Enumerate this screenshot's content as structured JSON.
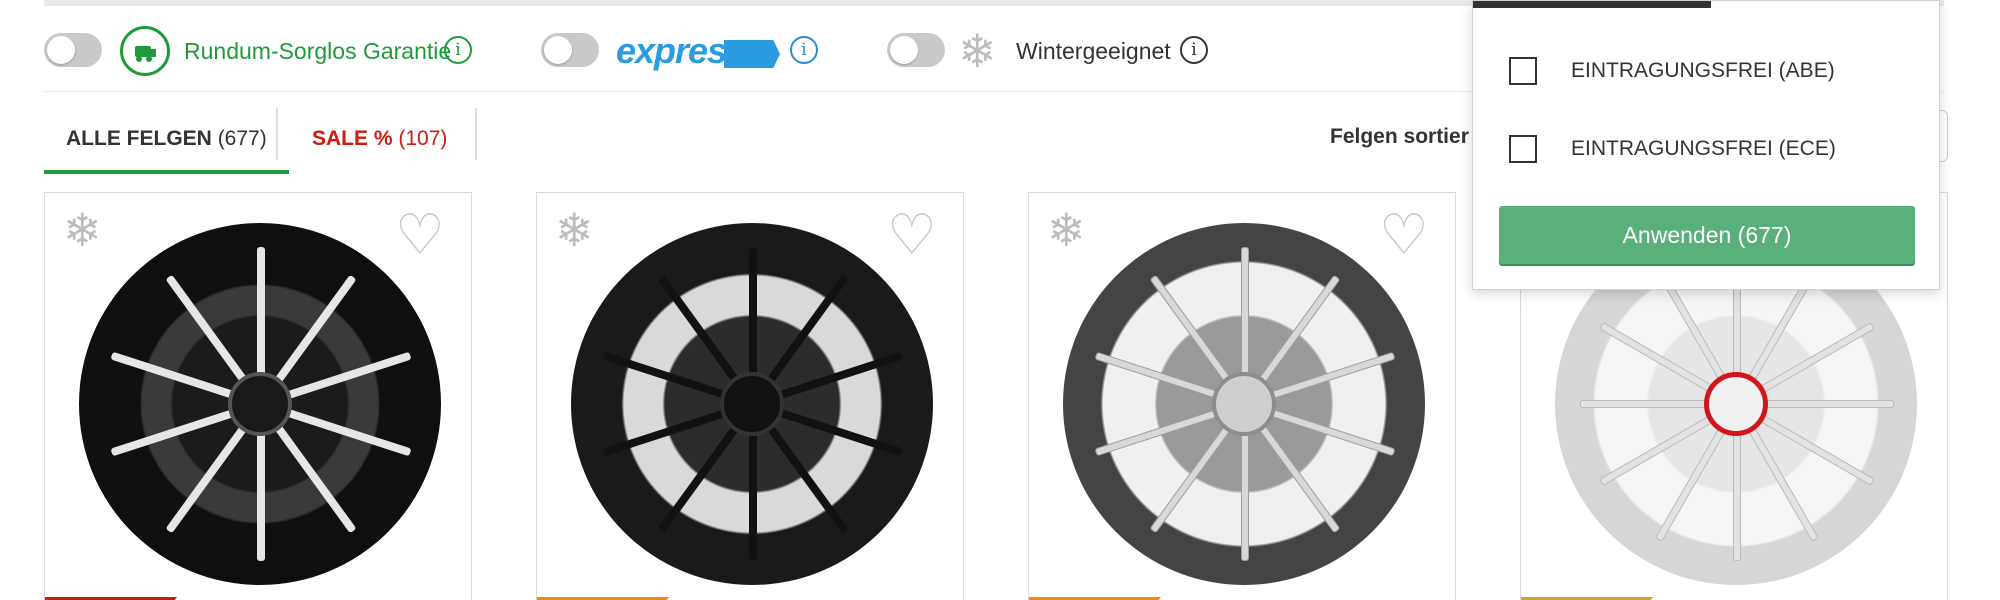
{
  "filters": {
    "rundum": {
      "label": "Rundum-Sorglos Garantie",
      "info": "i"
    },
    "express": {
      "label": "express",
      "info": "i"
    },
    "winter": {
      "label": "Wintergeeignet",
      "info": "i"
    }
  },
  "tabs": [
    {
      "label": "ALLE FELGEN",
      "count": "(677)"
    },
    {
      "label": "SALE %",
      "count": "(107)"
    }
  ],
  "sort": {
    "label": "Felgen sortier"
  },
  "dropdown": {
    "options": [
      {
        "label": "EINTRAGUNGSFREI (ABE)"
      },
      {
        "label": "EINTRAGUNGSFREI (ECE)"
      }
    ],
    "apply_label": "Anwenden (677)"
  },
  "products": [
    {
      "ribbon_color": "#c0200f"
    },
    {
      "ribbon_color": "#f08a10"
    },
    {
      "ribbon_color": "#f08a10"
    },
    {
      "ribbon_color": "#c9a227"
    }
  ],
  "colors": {
    "brand_green": "#1f9a3a",
    "express_blue": "#2a9be0",
    "sale_red": "#d0190f",
    "apply_green": "#5ab07b"
  },
  "icons": {
    "snowflake": "❄",
    "heart": "♡"
  }
}
